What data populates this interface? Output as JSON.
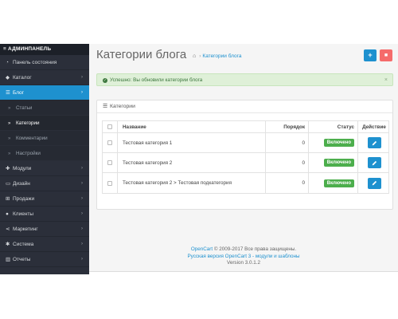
{
  "sidebar": {
    "header": "АДМИНПАНЕЛЬ",
    "items": [
      {
        "label": "Панель состояния",
        "icon": "dashboard-icon"
      },
      {
        "label": "Каталог",
        "icon": "tag-icon"
      },
      {
        "label": "Блог",
        "icon": "list-icon",
        "active": true
      },
      {
        "label": "Модули",
        "icon": "puzzle-icon"
      },
      {
        "label": "Дизайн",
        "icon": "monitor-icon"
      },
      {
        "label": "Продажи",
        "icon": "cart-icon"
      },
      {
        "label": "Клиенты",
        "icon": "user-icon"
      },
      {
        "label": "Маркетинг",
        "icon": "share-icon"
      },
      {
        "label": "Система",
        "icon": "gear-icon"
      },
      {
        "label": "Отчеты",
        "icon": "bar-chart-icon"
      }
    ],
    "blog_sub": [
      "Статьи",
      "Категории",
      "Комментарии",
      "Настройки"
    ]
  },
  "header": {
    "title": "Категории блога",
    "breadcrumb": "Категории блога"
  },
  "alert": {
    "text": "Успешно: Вы обновили категории блога",
    "close": "×"
  },
  "panel": {
    "title": "Категории"
  },
  "table": {
    "columns": [
      "Название",
      "Порядок",
      "Статус",
      "Действие"
    ],
    "rows": [
      {
        "name": "Тестовая категория 1",
        "order": "0",
        "status": "Включено"
      },
      {
        "name": "Тестовая категория 2",
        "order": "0",
        "status": "Включено"
      },
      {
        "name": "Тестовая категория 2 > Тестовая подкатегория",
        "order": "0",
        "status": "Включено"
      }
    ]
  },
  "footer": {
    "line1_link": "OpenCart",
    "line1_rest": " © 2009-2017 Все права защищены.",
    "line2": "Русская версия OpenCart 3 - модули и шаблоны",
    "line3": "Version 3.0.1.2"
  },
  "colors": {
    "sidebar_bg": "#2b2f3a",
    "accent": "#1e91cf",
    "success": "#4cae4c",
    "danger": "#f56b6b"
  }
}
